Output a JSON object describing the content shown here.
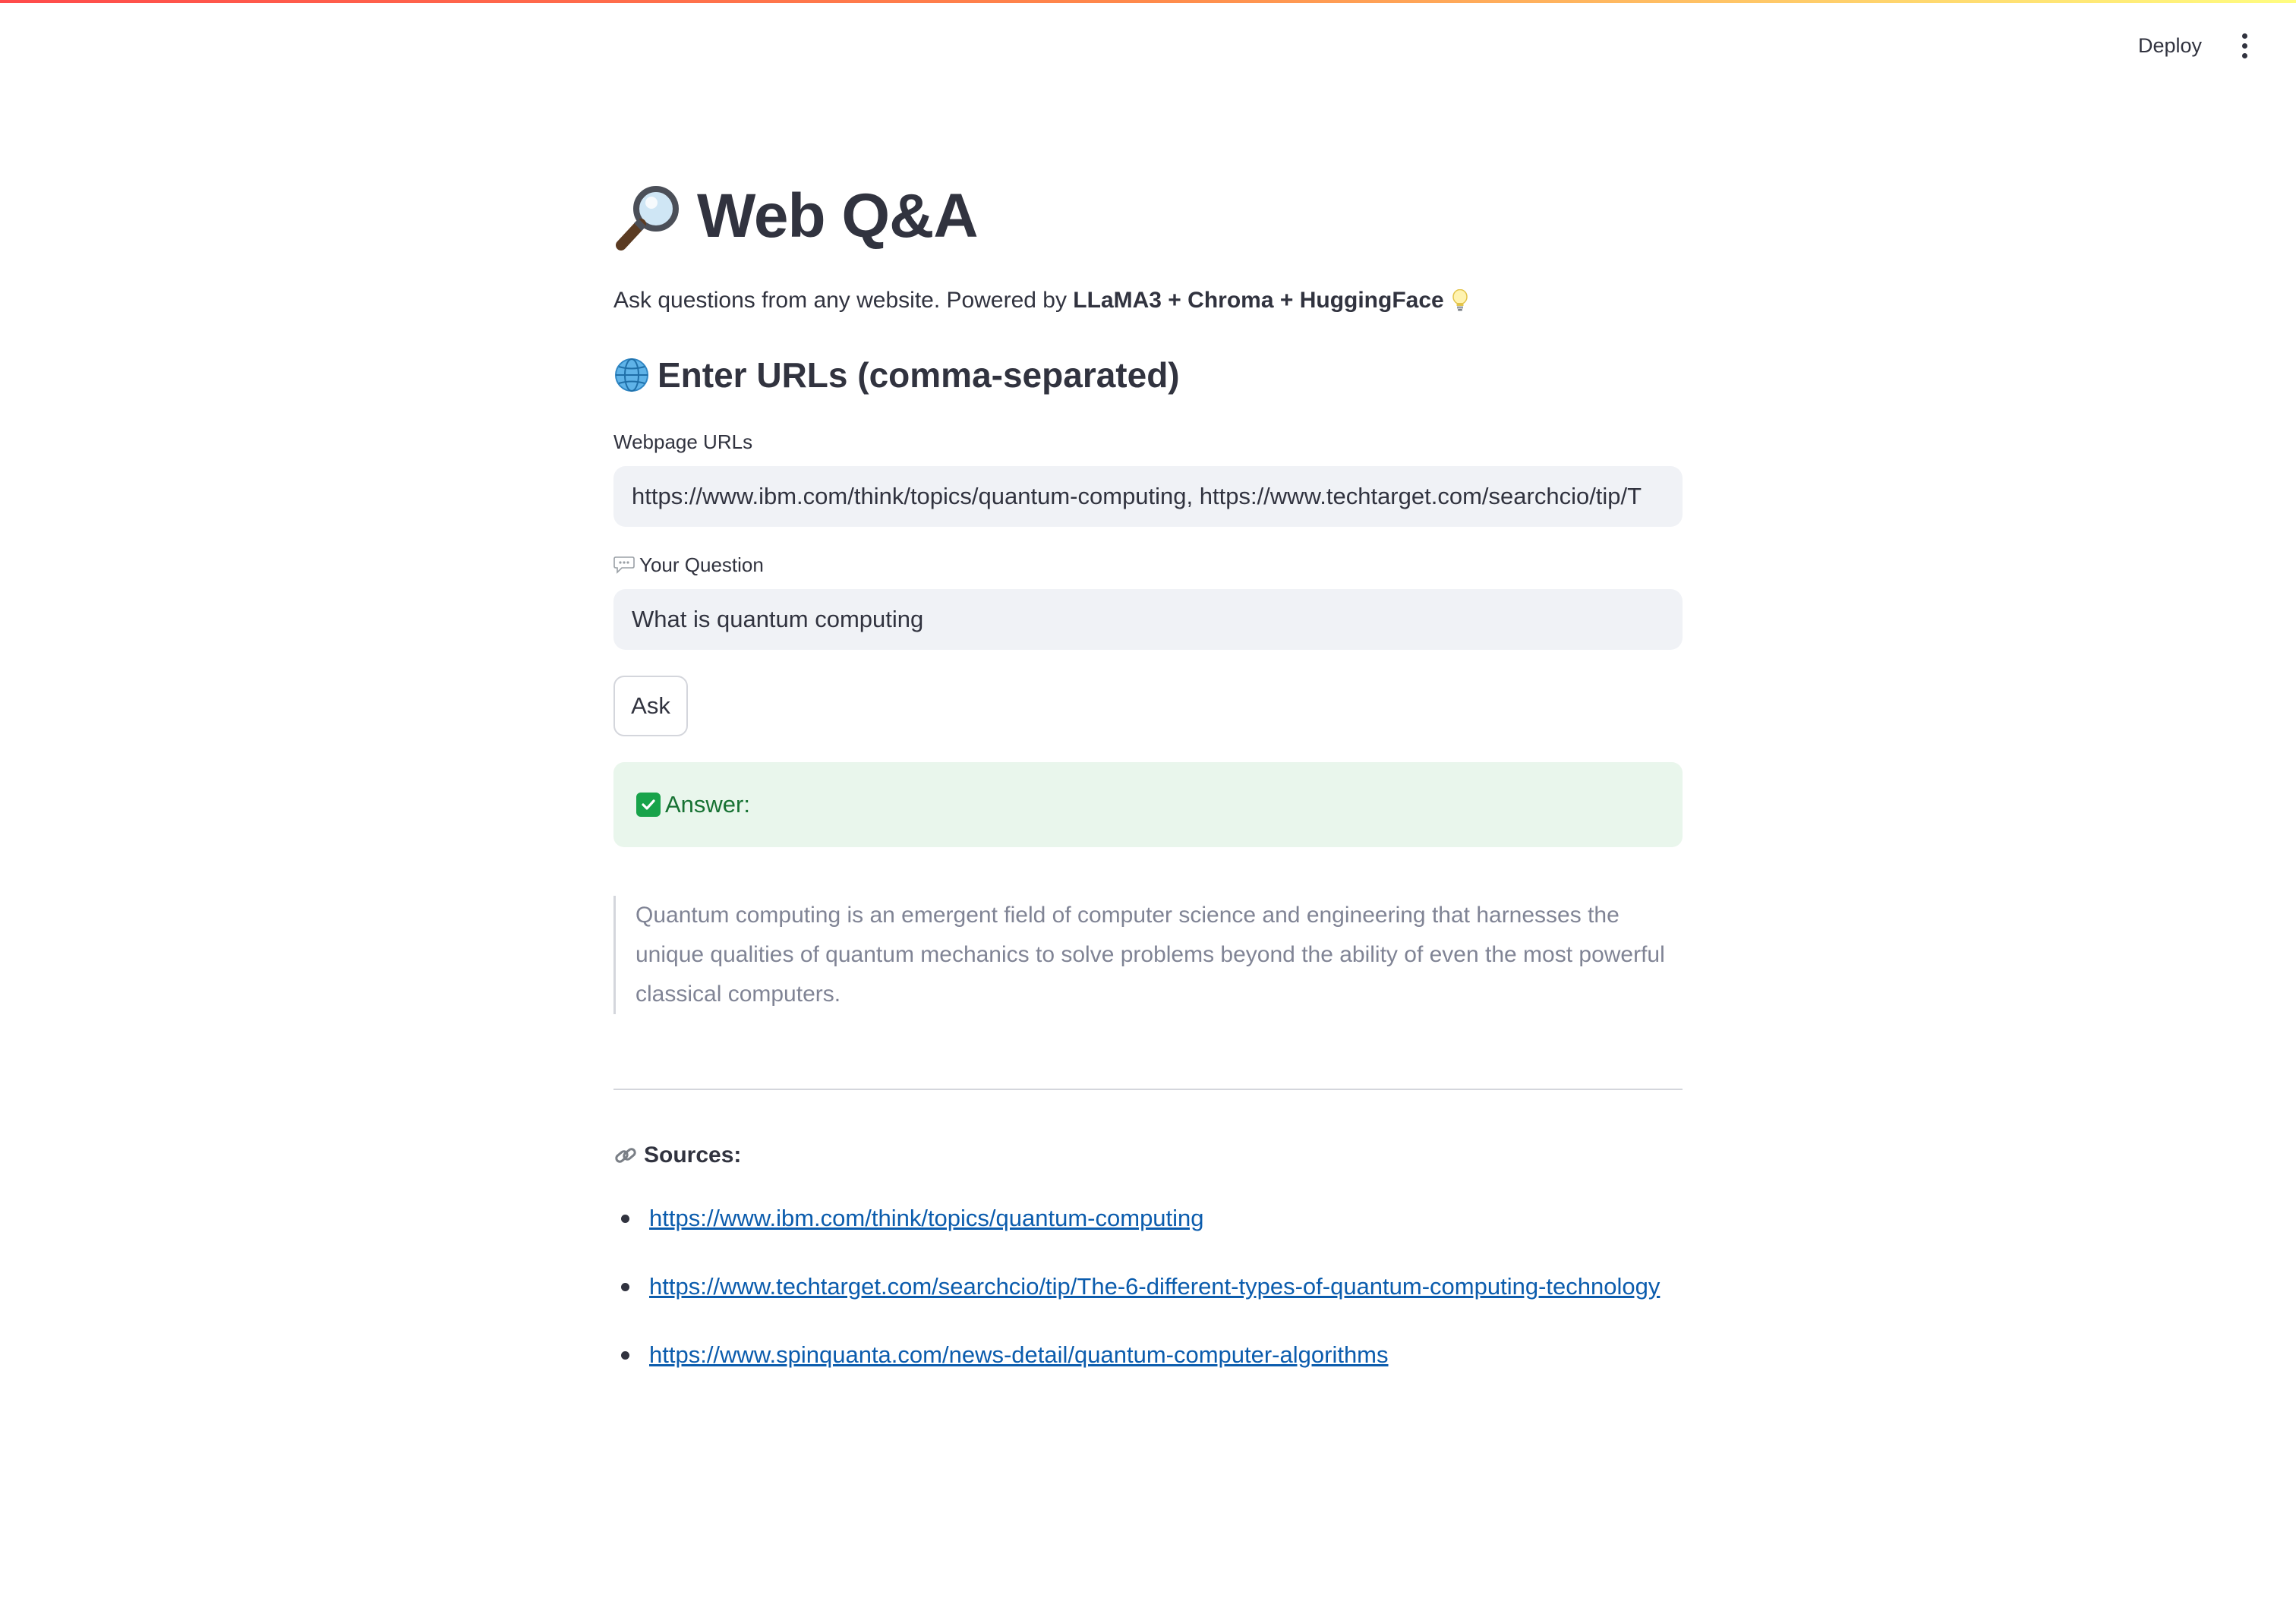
{
  "header": {
    "deploy_label": "Deploy",
    "menu_icon": "vertical-ellipsis-icon"
  },
  "page": {
    "title": "Web Q&A",
    "title_icon": "magnifying-glass-icon",
    "subtitle_prefix": "Ask questions from any website. Powered by ",
    "subtitle_bold": "LLaMA3 + Chroma + HuggingFace",
    "subtitle_icon": "light-bulb-icon"
  },
  "urls_section": {
    "heading": "Enter URLs (comma-separated)",
    "heading_icon": "globe-icon",
    "field_label": "Webpage URLs",
    "field_value": "https://www.ibm.com/think/topics/quantum-computing, https://www.techtarget.com/searchcio/tip/T"
  },
  "question": {
    "label": "Your Question",
    "label_icon": "speech-bubble-icon",
    "value": "What is quantum computing"
  },
  "ask_button": {
    "label": "Ask"
  },
  "answer": {
    "label": "Answer:",
    "icon": "check-mark-icon",
    "text": "Quantum computing is an emergent field of computer science and engineering that harnesses the unique qualities of quantum mechanics to solve problems beyond the ability of even the most powerful classical computers."
  },
  "sources": {
    "label": "Sources:",
    "icon": "link-icon",
    "items": [
      "https://www.ibm.com/think/topics/quantum-computing",
      "https://www.techtarget.com/searchcio/tip/The-6-different-types-of-quantum-computing-technology",
      "https://www.spinquanta.com/news-detail/quantum-computer-algorithms"
    ]
  },
  "colors": {
    "accent_gradient_start": "#ff4b4b",
    "accent_gradient_end": "#fffd80",
    "answer_bg": "#e9f6ec",
    "answer_text": "#177233",
    "link": "#0b5cad",
    "input_bg": "#f0f2f6"
  }
}
